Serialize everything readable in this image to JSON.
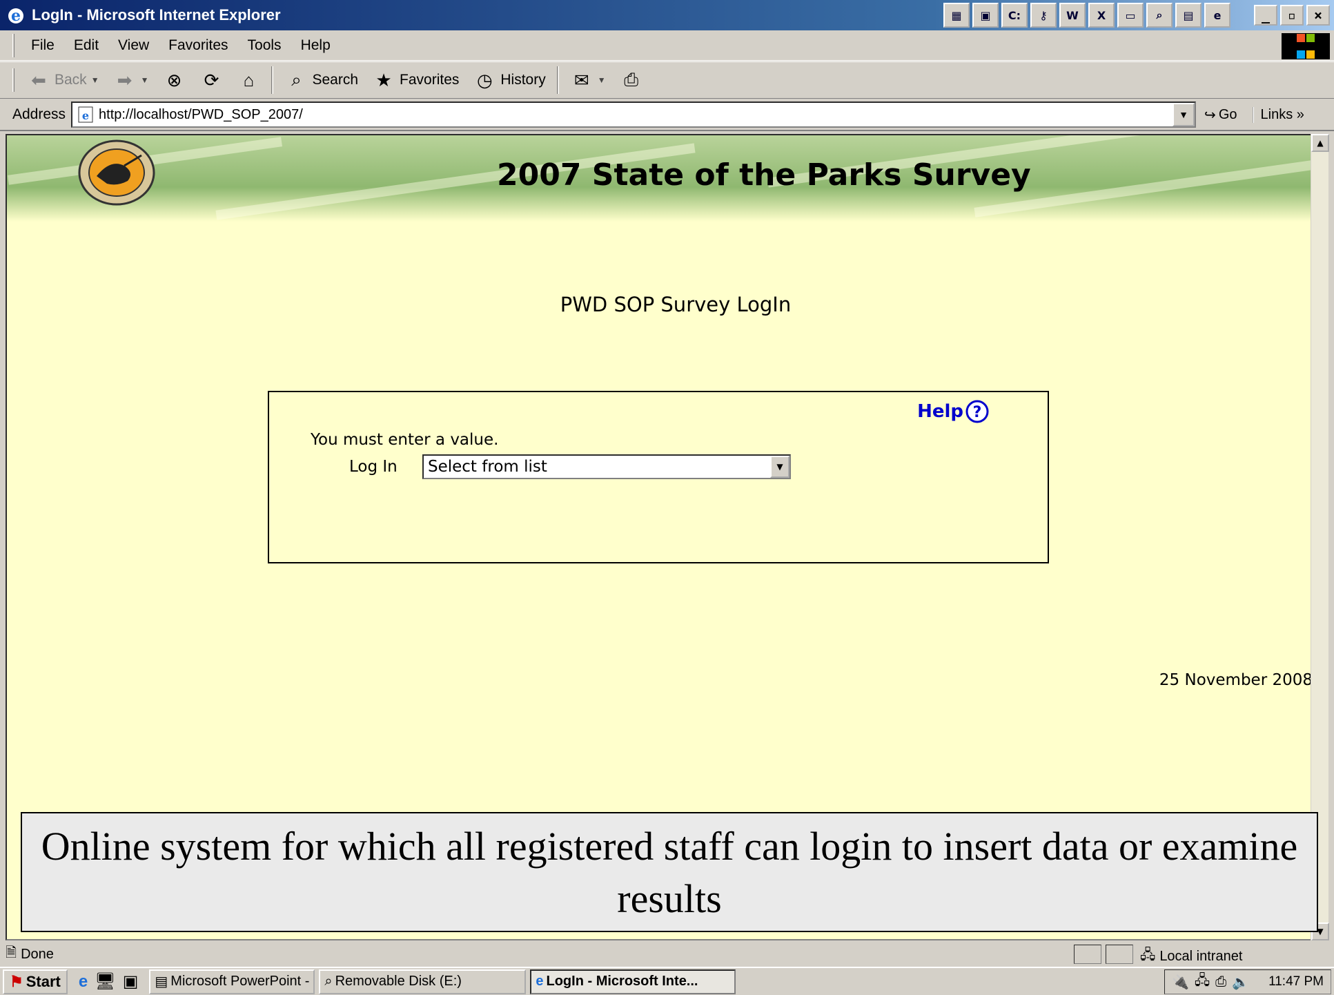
{
  "window": {
    "title": "LogIn - Microsoft Internet Explorer"
  },
  "tray_icons": [
    "app-icon",
    "screen-icon",
    "terminal-icon",
    "key-icon",
    "word-icon",
    "excel-icon",
    "window-icon",
    "search-icon",
    "calculator-icon",
    "ie-icon"
  ],
  "menu": {
    "items": [
      "File",
      "Edit",
      "View",
      "Favorites",
      "Tools",
      "Help"
    ]
  },
  "toolbar": {
    "back_label": "Back",
    "search_label": "Search",
    "favorites_label": "Favorites",
    "history_label": "History"
  },
  "address": {
    "label": "Address",
    "url": "http://localhost/PWD_SOP_2007/",
    "go_label": "Go",
    "links_label": "Links"
  },
  "banner": {
    "title": "2007 State of the Parks Survey"
  },
  "page": {
    "heading": "PWD SOP Survey LogIn",
    "help_label": "Help",
    "validation_message": "You must enter a value.",
    "login_label": "Log In",
    "login_select_value": "Select from list",
    "date": "25 November 2008"
  },
  "caption": "Online system for which all registered staff can login to insert data or examine results",
  "status": {
    "text": "Done",
    "zone": "Local intranet"
  },
  "taskbar": {
    "start_label": "Start",
    "tasks": [
      "Microsoft PowerPoint - [A...",
      "Removable Disk (E:)",
      "LogIn - Microsoft Inte..."
    ],
    "clock": "11:47 PM"
  },
  "colors": {
    "page_bg": "#ffffcc",
    "help_link": "#0000cc",
    "titlebar": "#0a246a"
  }
}
